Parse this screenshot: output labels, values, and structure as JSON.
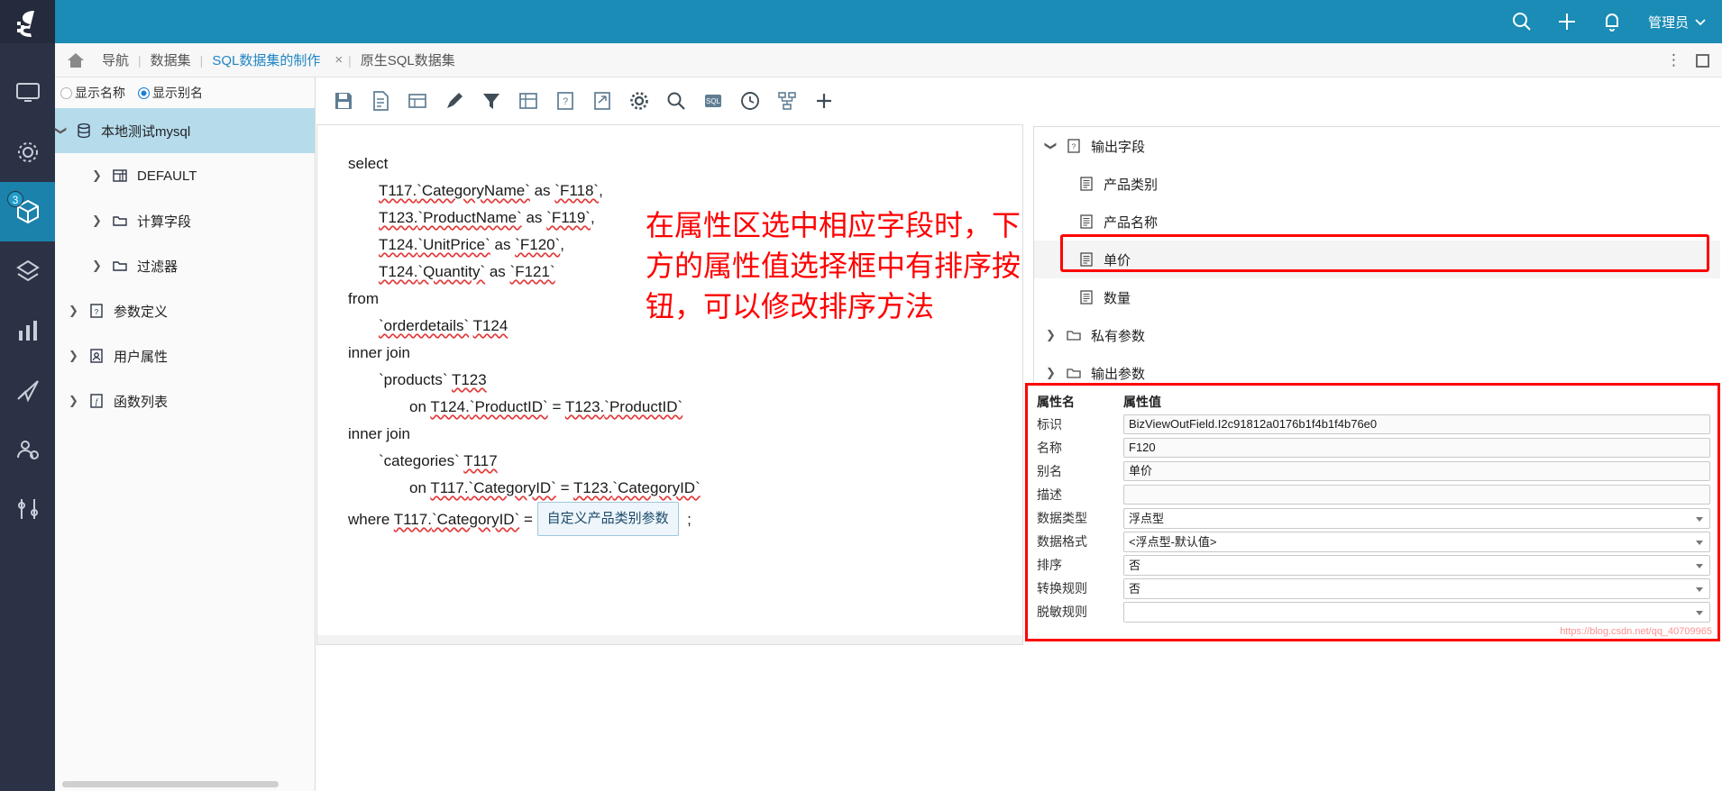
{
  "header": {
    "icons": [
      "search-icon",
      "plus-icon",
      "bell-icon"
    ],
    "user_label": "管理员",
    "chevron": "⌄"
  },
  "breadcrumb": {
    "home_icon": "home-icon",
    "items": [
      {
        "label": "导航",
        "link": false
      },
      {
        "label": "数据集",
        "link": false
      },
      {
        "label": "SQL数据集的制作",
        "link": true,
        "closable": true
      },
      {
        "label": "原生SQL数据集",
        "link": false
      }
    ],
    "separator": "|",
    "close_glyph": "×",
    "more_glyph": "⋮"
  },
  "rail": {
    "logo": "smartbi-logo",
    "items": [
      {
        "icon": "monitor-icon",
        "active": false,
        "badge": null
      },
      {
        "icon": "settings-gear-icon",
        "active": false,
        "badge": null
      },
      {
        "icon": "cube-dataset-icon",
        "active": true,
        "badge": "3"
      },
      {
        "icon": "layers-icon",
        "active": false,
        "badge": null
      },
      {
        "icon": "bar-chart-icon",
        "active": false,
        "badge": null
      },
      {
        "icon": "send-plane-icon",
        "active": false,
        "badge": null
      },
      {
        "icon": "user-gear-icon",
        "active": false,
        "badge": null
      },
      {
        "icon": "tools-icon",
        "active": false,
        "badge": null
      }
    ]
  },
  "sidebar": {
    "display_options": [
      {
        "label": "显示名称",
        "selected": false
      },
      {
        "label": "显示别名",
        "selected": true
      }
    ],
    "tree": [
      {
        "label": "本地测试mysql",
        "icon": "database-icon",
        "level": 0,
        "expanded": true,
        "selected": true
      },
      {
        "label": "DEFAULT",
        "icon": "table-grid-icon",
        "level": 1,
        "expanded": false,
        "selected": false
      },
      {
        "label": "计算字段",
        "icon": "folder-icon",
        "level": 1,
        "expanded": false,
        "selected": false
      },
      {
        "label": "过滤器",
        "icon": "folder-icon",
        "level": 1,
        "expanded": false,
        "selected": false
      },
      {
        "label": "参数定义",
        "icon": "param-icon",
        "level": 0,
        "expanded": false,
        "selected": false
      },
      {
        "label": "用户属性",
        "icon": "user-attr-icon",
        "level": 0,
        "expanded": false,
        "selected": false
      },
      {
        "label": "函数列表",
        "icon": "function-icon",
        "level": 0,
        "expanded": false,
        "selected": false
      }
    ]
  },
  "toolbar": {
    "buttons": [
      {
        "name": "save-icon",
        "title": "保存"
      },
      {
        "name": "save-as-icon",
        "title": "另存为"
      },
      {
        "name": "table-view-icon",
        "title": "表格"
      },
      {
        "name": "brush-icon",
        "title": "格式刷"
      },
      {
        "name": "filter-icon",
        "title": "过滤"
      },
      {
        "name": "grid-icon",
        "title": "网格"
      },
      {
        "name": "param-question-icon",
        "title": "参数"
      },
      {
        "name": "export-icon",
        "title": "导出"
      },
      {
        "name": "gear-icon",
        "title": "设置"
      },
      {
        "name": "search-icon",
        "title": "查找"
      },
      {
        "name": "sql-icon",
        "title": "SQL"
      },
      {
        "name": "clock-icon",
        "title": "历史"
      },
      {
        "name": "relation-icon",
        "title": "关系"
      },
      {
        "name": "plus-icon",
        "title": "新增"
      }
    ]
  },
  "sql": {
    "lines": [
      {
        "indent": 0,
        "parts": [
          {
            "t": "select",
            "s": "plain"
          }
        ]
      },
      {
        "indent": 1,
        "parts": [
          {
            "t": "T117.",
            "s": "uls"
          },
          {
            "t": "`CategoryName`",
            "s": "uls"
          },
          {
            "t": " as ",
            "s": "plain"
          },
          {
            "t": "`F118`",
            "s": "uls"
          },
          {
            "t": ",",
            "s": "plain"
          }
        ]
      },
      {
        "indent": 1,
        "parts": [
          {
            "t": "T123.",
            "s": "uls"
          },
          {
            "t": "`ProductName`",
            "s": "uls"
          },
          {
            "t": " as ",
            "s": "plain"
          },
          {
            "t": "`F119`",
            "s": "uls"
          },
          {
            "t": ",",
            "s": "plain"
          }
        ]
      },
      {
        "indent": 1,
        "parts": [
          {
            "t": "T124.",
            "s": "uls"
          },
          {
            "t": "`UnitPrice`",
            "s": "uls"
          },
          {
            "t": " as ",
            "s": "plain"
          },
          {
            "t": "`F120`",
            "s": "uls"
          },
          {
            "t": ",",
            "s": "plain"
          }
        ]
      },
      {
        "indent": 1,
        "parts": [
          {
            "t": "T124.",
            "s": "uls"
          },
          {
            "t": "`Quantity`",
            "s": "uls"
          },
          {
            "t": " as ",
            "s": "plain"
          },
          {
            "t": "`F121`",
            "s": "uls"
          }
        ]
      },
      {
        "indent": 0,
        "parts": [
          {
            "t": "from",
            "s": "plain"
          }
        ]
      },
      {
        "indent": 1,
        "parts": [
          {
            "t": "`orderdetails`",
            "s": "uls"
          },
          {
            "t": " ",
            "s": "plain"
          },
          {
            "t": "T124",
            "s": "uls"
          }
        ]
      },
      {
        "indent": 0,
        "parts": [
          {
            "t": "inner join",
            "s": "plain"
          }
        ]
      },
      {
        "indent": 1,
        "parts": [
          {
            "t": "`products`",
            "s": "plain"
          },
          {
            "t": " ",
            "s": "plain"
          },
          {
            "t": "T123",
            "s": "uls"
          }
        ]
      },
      {
        "indent": 2,
        "parts": [
          {
            "t": "on ",
            "s": "plain"
          },
          {
            "t": "T124.",
            "s": "uls"
          },
          {
            "t": "`ProductID`",
            "s": "uls"
          },
          {
            "t": " = ",
            "s": "plain"
          },
          {
            "t": "T123.",
            "s": "uls"
          },
          {
            "t": "`ProductID`",
            "s": "uls"
          }
        ]
      },
      {
        "indent": 0,
        "parts": [
          {
            "t": "inner join",
            "s": "plain"
          }
        ]
      },
      {
        "indent": 1,
        "parts": [
          {
            "t": "`categories`",
            "s": "plain"
          },
          {
            "t": " ",
            "s": "plain"
          },
          {
            "t": "T117",
            "s": "uls"
          }
        ]
      },
      {
        "indent": 2,
        "parts": [
          {
            "t": "on ",
            "s": "plain"
          },
          {
            "t": "T117.",
            "s": "uls"
          },
          {
            "t": "`CategoryID`",
            "s": "uls"
          },
          {
            "t": " = ",
            "s": "plain"
          },
          {
            "t": "T123.",
            "s": "uls"
          },
          {
            "t": "`CategoryID`",
            "s": "uls"
          }
        ]
      }
    ],
    "where_prefix": "where ",
    "where_table": "T117.",
    "where_col": "`CategoryID`",
    "where_eq": " = ",
    "where_param": "自定义产品类别参数",
    "where_suffix": ";"
  },
  "annotation": {
    "text": "在属性区选中相应字段时，下方的属性值选择框中有排序按钮，可以修改排序方法",
    "color": "#ff0000"
  },
  "output_fields": {
    "tree": [
      {
        "label": "输出字段",
        "icon": "question-doc-icon",
        "level": 0,
        "expanded": true,
        "highlight": false
      },
      {
        "label": "产品类别",
        "icon": "field-icon",
        "level": 1,
        "expanded": null,
        "highlight": false
      },
      {
        "label": "产品名称",
        "icon": "field-icon",
        "level": 1,
        "expanded": null,
        "highlight": false
      },
      {
        "label": "单价",
        "icon": "field-icon",
        "level": 1,
        "expanded": null,
        "highlight": true
      },
      {
        "label": "数量",
        "icon": "field-icon",
        "level": 1,
        "expanded": null,
        "highlight": false
      },
      {
        "label": "私有参数",
        "icon": "folder-icon",
        "level": 0,
        "expanded": false,
        "highlight": false
      },
      {
        "label": "输出参数",
        "icon": "folder-icon",
        "level": 0,
        "expanded": false,
        "highlight": false
      }
    ]
  },
  "properties": {
    "col_name_header": "属性名",
    "col_value_header": "属性值",
    "rows": [
      {
        "name": "标识",
        "value": "BizViewOutField.I2c91812a0176b1f4b1f4b76e0",
        "type": "input"
      },
      {
        "name": "名称",
        "value": "F120",
        "type": "input"
      },
      {
        "name": "别名",
        "value": "单价",
        "type": "input"
      },
      {
        "name": "描述",
        "value": "",
        "type": "input"
      },
      {
        "name": "数据类型",
        "value": "浮点型",
        "type": "select"
      },
      {
        "name": "数据格式",
        "value": "<浮点型-默认值>",
        "type": "select"
      },
      {
        "name": "排序",
        "value": "否",
        "type": "select"
      },
      {
        "name": "转换规则",
        "value": "否",
        "type": "select"
      },
      {
        "name": "脱敏规则",
        "value": "",
        "type": "select"
      }
    ]
  },
  "watermark": {
    "text": "https://blog.csdn.net/qq_40709965"
  }
}
